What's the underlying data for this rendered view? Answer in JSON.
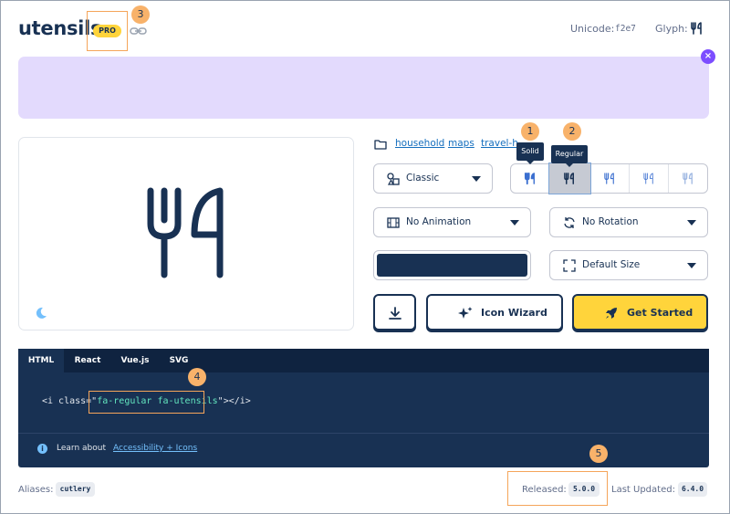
{
  "header": {
    "title": "utensils",
    "badge": "PRO",
    "unicode_label": "Unicode:",
    "unicode_value": "f2e7",
    "glyph_label": "Glyph:"
  },
  "markers": [
    "1",
    "2",
    "3",
    "4",
    "5"
  ],
  "categories": [
    "household",
    "maps",
    "travel-h"
  ],
  "tooltips": {
    "solid": "Solid",
    "regular": "Regular"
  },
  "family_dropdown": {
    "label": "Classic",
    "icon": "shapes-icon"
  },
  "animation_dropdown": {
    "label": "No Animation",
    "icon": "film-icon"
  },
  "rotation_dropdown": {
    "label": "No Rotation",
    "icon": "rotate-icon"
  },
  "size_dropdown": {
    "label": "Default Size",
    "icon": "expand-icon"
  },
  "style_buttons": [
    "solid",
    "regular",
    "light",
    "thin",
    "duotone"
  ],
  "icon_color": "#183153",
  "actions": {
    "wizard": "Icon Wizard",
    "get_started": "Get Started"
  },
  "code": {
    "tabs": [
      "HTML",
      "React",
      "Vue.js",
      "SVG"
    ],
    "active_tab": "HTML",
    "prefix": "<i class=\"",
    "classes": "fa-regular fa-utensils",
    "suffix": "\"></i>",
    "learn_about": "Learn about",
    "learn_link": "Accessibility + Icons"
  },
  "footer": {
    "aliases_label": "Aliases:",
    "alias": "cutlery",
    "released_label": "Released:",
    "released_version": "5.0.0",
    "updated_label": "Last Updated:",
    "updated_version": "6.4.0"
  }
}
